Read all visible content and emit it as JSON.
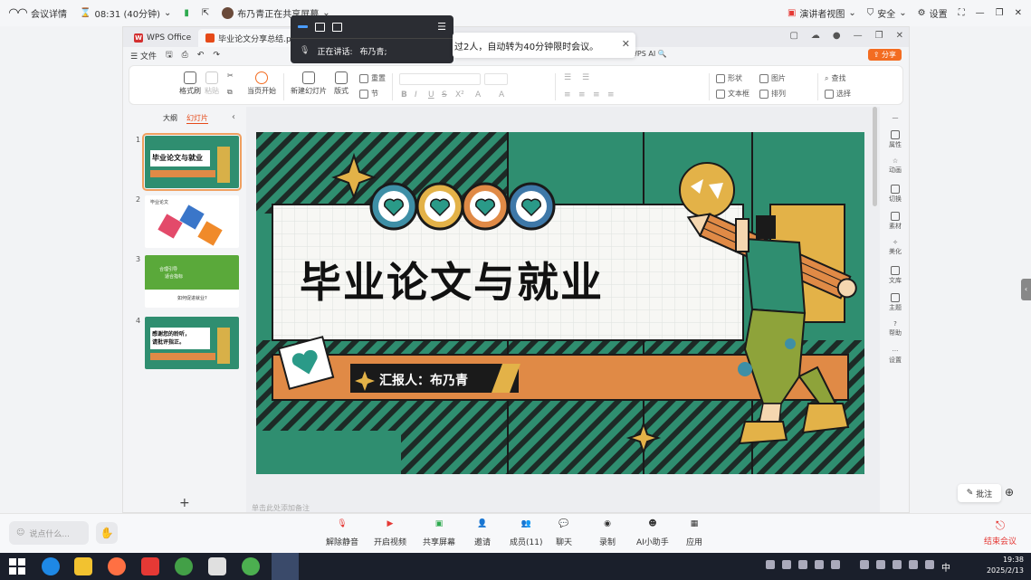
{
  "meeting": {
    "details_label": "会议详情",
    "time_label": "08:31 (40分钟)",
    "sharing_label": "布乃青正在共享屏幕",
    "presenter_view": "演讲者视图",
    "security": "安全",
    "settings": "设置",
    "notice_text": "过2人，自动转为40分钟限时会议。",
    "speaking_label": "正在讲话:",
    "speaker_name": "布乃青;"
  },
  "wps": {
    "tabs": [
      {
        "label": "WPS Office"
      },
      {
        "label": "毕业论文分享总结.pptx"
      }
    ],
    "menu_file": "文件",
    "wps_ai": "WPS AI",
    "share": "分享",
    "ribbon": {
      "format_painter": "格式刷",
      "paste": "粘贴",
      "play": "当页开始",
      "new_slide": "新建幻灯片",
      "layout": "版式",
      "reset": "重置",
      "section": "节",
      "shape": "形状",
      "picture": "图片",
      "find": "查找",
      "textbox": "文本框",
      "arrange": "排列",
      "select": "选择",
      "format_buttons": [
        "B",
        "I",
        "U",
        "S",
        "X²",
        "A",
        "A"
      ]
    },
    "left_tabs": {
      "outline": "大纲",
      "slides": "幻灯片"
    },
    "thumbnails": [
      {
        "num": "1",
        "title": "毕业论文与就业"
      },
      {
        "num": "2",
        "title": "毕业论文"
      },
      {
        "num": "3",
        "title": "合理引导",
        "subtitle": "适合指标",
        "q": "如何促进就业?"
      },
      {
        "num": "4",
        "title": "感谢您的聆听，",
        "title2": "请批评指正。"
      }
    ],
    "notes_placeholder": "单击此处添加备注",
    "right_sidebar": [
      "属性",
      "动画",
      "切换",
      "素材",
      "美化",
      "文库",
      "主题",
      "帮助",
      "设置"
    ],
    "slide": {
      "title": "毕业论文与就业",
      "reporter": "汇报人：布乃青"
    }
  },
  "bottom": {
    "say_placeholder": "说点什么...",
    "buttons": [
      {
        "label": "解除静音"
      },
      {
        "label": "开启视频"
      },
      {
        "label": "共享屏幕"
      },
      {
        "label": "邀请"
      },
      {
        "label": "成员(11)"
      },
      {
        "label": "聊天"
      },
      {
        "label": "录制"
      },
      {
        "label": "AI小助手"
      },
      {
        "label": "应用"
      }
    ],
    "end": "结束会议",
    "annotate": "批注"
  },
  "taskbar": {
    "ime": "中",
    "time": "19:38",
    "date": "2025/2/13"
  },
  "colors": {
    "slide_green": "#2f8e70",
    "accent_orange": "#e08a46",
    "share_orange": "#f36c21",
    "end_red": "#e53935"
  }
}
